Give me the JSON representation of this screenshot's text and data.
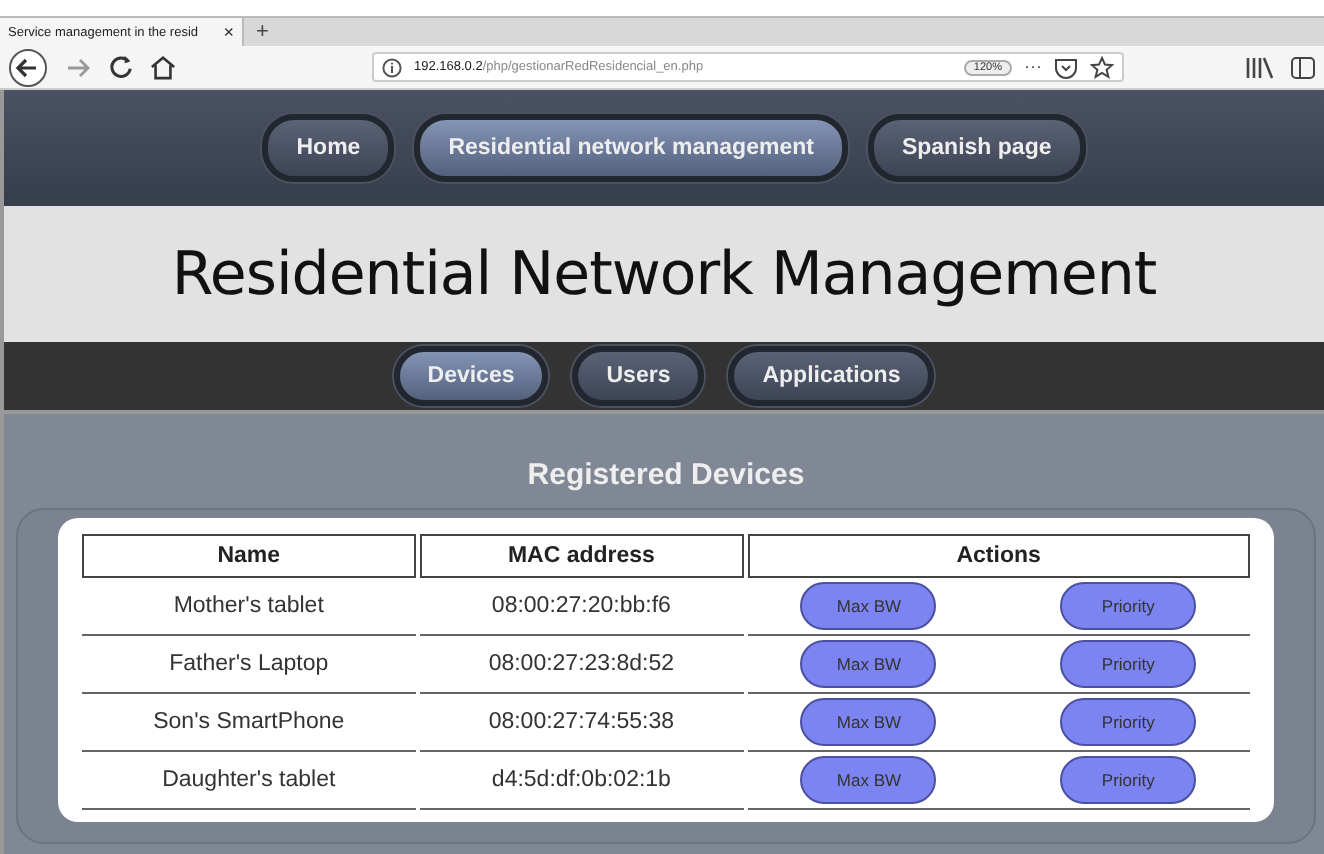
{
  "browser": {
    "tab_title": "Service management in the resid",
    "tab_close": "×",
    "new_tab": "+",
    "url_host": "192.168.0.2",
    "url_path": "/php/gestionarRedResidencial_en.php",
    "zoom": "120%",
    "menu_dots": "···"
  },
  "main_nav": [
    {
      "label": "Home",
      "selected": false
    },
    {
      "label": "Residential network management",
      "selected": true
    },
    {
      "label": "Spanish page",
      "selected": false
    }
  ],
  "page_title": "Residential Network Management",
  "sub_nav": [
    {
      "label": "Devices",
      "selected": true
    },
    {
      "label": "Users",
      "selected": false
    },
    {
      "label": "Applications",
      "selected": false
    }
  ],
  "section_title": "Registered Devices",
  "table": {
    "columns": [
      "Name",
      "MAC address",
      "Actions"
    ],
    "rows": [
      {
        "name": "Mother's tablet",
        "mac": "08:00:27:20:bb:f6",
        "actions": [
          "Max BW",
          "Priority"
        ]
      },
      {
        "name": "Father's Laptop",
        "mac": "08:00:27:23:8d:52",
        "actions": [
          "Max BW",
          "Priority"
        ]
      },
      {
        "name": "Son's SmartPhone",
        "mac": "08:00:27:74:55:38",
        "actions": [
          "Max BW",
          "Priority"
        ]
      },
      {
        "name": "Daughter's tablet",
        "mac": "d4:5d:df:0b:02:1b",
        "actions": [
          "Max BW",
          "Priority"
        ]
      }
    ]
  }
}
